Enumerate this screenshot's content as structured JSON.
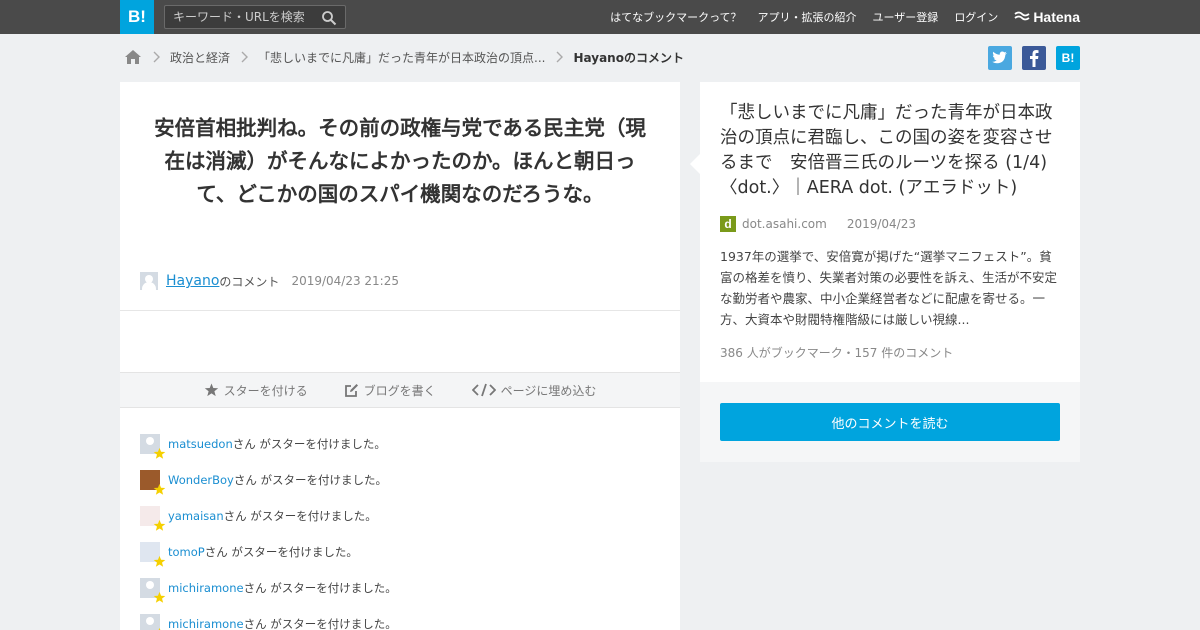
{
  "header": {
    "logo_text": "B!",
    "search_placeholder": "キーワード・URLを検索",
    "nav": [
      "はてなブックマークって？",
      "アプリ・拡張の紹介",
      "ユーザー登録",
      "ログイン"
    ],
    "brand": "Hatena"
  },
  "breadcrumb": {
    "items": [
      "政治と経済",
      "「悲しいまでに凡庸」だった青年が日本政治の頂点..."
    ],
    "current": "Hayanoのコメント"
  },
  "share": {
    "hatena_label": "B!"
  },
  "comment": {
    "text": "安倍首相批判ね。その前の政権与党である民主党（現在は消滅）がそんなによかったのか。ほんと朝日って、どこかの国のスパイ機関なのだろうな。",
    "user": "Hayano",
    "suffix": "のコメント",
    "date": "2019/04/23 21:25"
  },
  "actions": [
    "スターを付ける",
    "ブログを書く",
    "ページに埋め込む"
  ],
  "stars": {
    "suffix": "さん がスターを付けました。",
    "users": [
      "matsuedon",
      "WonderBoy",
      "yamaisan",
      "tomoP",
      "michiramone",
      "michiramone"
    ]
  },
  "page": {
    "title": "「悲しいまでに凡庸」だった青年が日本政治の頂点に君臨し、この国の姿を変容させるまで　安倍晋三氏のルーツを探る (1/4) 〈dot.〉｜AERA dot. (アエラドット)",
    "favicon": "d",
    "domain": "dot.asahi.com",
    "date": "2019/04/23",
    "summary": "1937年の選挙で、安倍寛が掲げた“選挙マニフェスト”。貧富の格差を憤り、失業者対策の必要性を訴え、生活が不安定な勤労者や農家、中小企業経営者などに配慮を寄せる。一方、大資本や財閥特権階級には厳しい視線...",
    "counts": "386 人がブックマーク・157 件のコメント",
    "read_more": "他のコメントを読む"
  },
  "colors": {
    "accent": "#00a4de",
    "header": "#4a4a4a",
    "link": "#1a8ed1",
    "twitter": "#4aa8e0",
    "facebook": "#3b5998",
    "star": "#f5d000"
  }
}
